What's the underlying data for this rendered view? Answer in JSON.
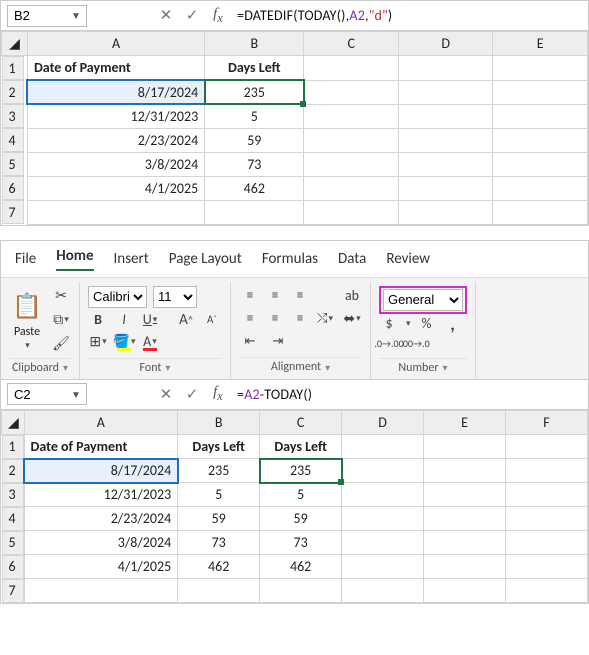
{
  "sheet1": {
    "namebox": "B2",
    "formula_parts": {
      "fn": "DATEDIF",
      "today": "TODAY",
      "ref": "A2",
      "arg": "\"d\""
    },
    "columns": [
      "A",
      "B",
      "C",
      "D",
      "E"
    ],
    "headers": {
      "A": "Date of Payment",
      "B": "Days Left"
    },
    "rows": [
      {
        "n": "1"
      },
      {
        "n": "2",
        "A": "8/17/2024",
        "B": "235"
      },
      {
        "n": "3",
        "A": "12/31/2023",
        "B": "5"
      },
      {
        "n": "4",
        "A": "2/23/2024",
        "B": "59"
      },
      {
        "n": "5",
        "A": "3/8/2024",
        "B": "73"
      },
      {
        "n": "6",
        "A": "4/1/2025",
        "B": "462"
      },
      {
        "n": "7"
      }
    ],
    "active_col": "B",
    "active_row": "2"
  },
  "ribbon": {
    "tabs": [
      "File",
      "Home",
      "Insert",
      "Page Layout",
      "Formulas",
      "Data",
      "Review"
    ],
    "active_tab": "Home",
    "clipboard": {
      "paste": "Paste",
      "label": "Clipboard"
    },
    "font": {
      "name": "Calibri",
      "size": "11",
      "label": "Font",
      "bold": "B",
      "italic": "I",
      "underline": "U",
      "grow": "A",
      "shrink": "A"
    },
    "alignment": {
      "label": "Alignment",
      "wrap": "ab"
    },
    "number": {
      "format": "General",
      "label": "Number",
      "currency": "$",
      "percent": "%",
      "comma": ",",
      "inc": ".00→.0",
      "dec": ".0→.00"
    }
  },
  "sheet2": {
    "namebox": "C2",
    "formula_parts": {
      "ref": "A2",
      "today": "TODAY"
    },
    "columns": [
      "A",
      "B",
      "C",
      "D",
      "E",
      "F"
    ],
    "headers": {
      "A": "Date of Payment",
      "B": "Days Left",
      "C": "Days Left"
    },
    "rows": [
      {
        "n": "1"
      },
      {
        "n": "2",
        "A": "8/17/2024",
        "B": "235",
        "C": "235"
      },
      {
        "n": "3",
        "A": "12/31/2023",
        "B": "5",
        "C": "5"
      },
      {
        "n": "4",
        "A": "2/23/2024",
        "B": "59",
        "C": "59"
      },
      {
        "n": "5",
        "A": "3/8/2024",
        "B": "73",
        "C": "73"
      },
      {
        "n": "6",
        "A": "4/1/2025",
        "B": "462",
        "C": "462"
      },
      {
        "n": "7"
      }
    ],
    "active_col": "C",
    "active_row": "2"
  }
}
